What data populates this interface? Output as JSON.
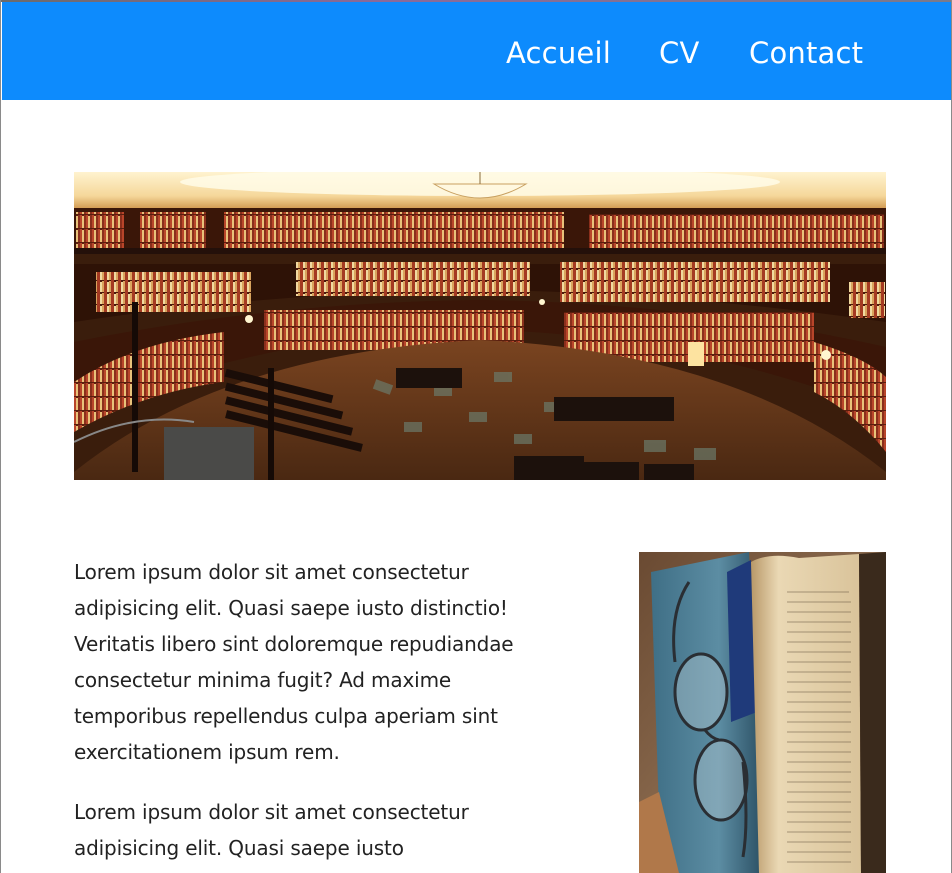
{
  "nav": {
    "links": [
      {
        "label": "Accueil"
      },
      {
        "label": "CV"
      },
      {
        "label": "Contact"
      }
    ]
  },
  "colors": {
    "navbar": "#0d8bfd",
    "nav_text": "#ffffff",
    "body_text": "#222222"
  },
  "hero_image": {
    "subject": "panoramic interior of a circular library with bookshelves"
  },
  "content": {
    "paragraphs": [
      "Lorem ipsum dolor sit amet consectetur adipisicing elit. Quasi saepe iusto distinctio! Veritatis libero sint doloremque repudiandae consectetur minima fugit? Ad maxime temporibus repellendus culpa aperiam sint exercitationem ipsum rem.",
      "Lorem ipsum dolor sit amet consectetur adipisicing elit. Quasi saepe iusto"
    ]
  },
  "side_image": {
    "subject": "open book with eyeglasses resting on a blue book"
  }
}
